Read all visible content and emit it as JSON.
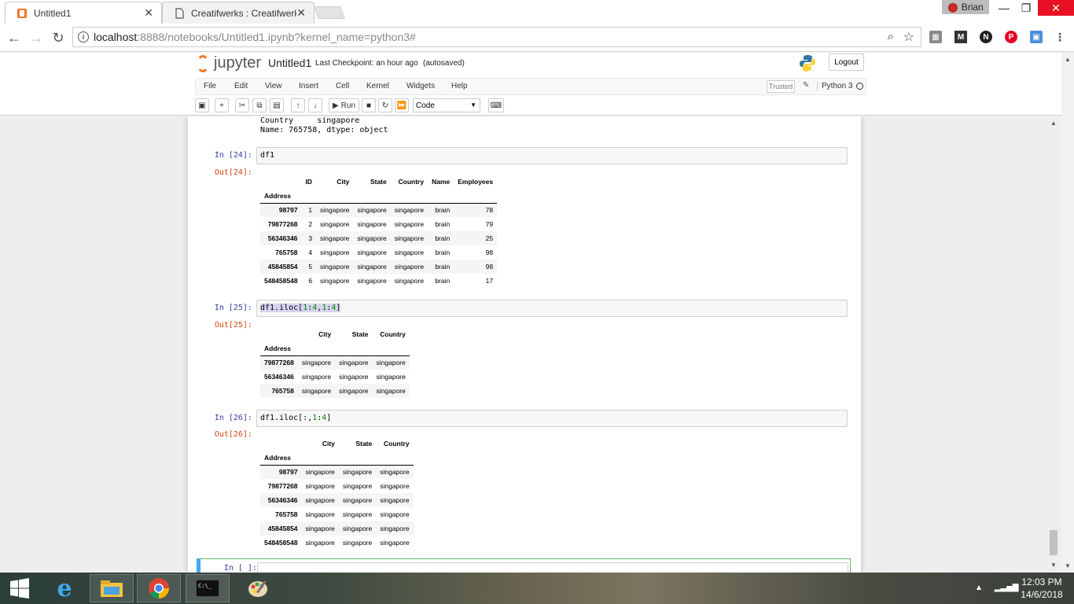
{
  "browser": {
    "tabs": [
      {
        "title": "Untitled1",
        "active": true
      },
      {
        "title": "Creatifwerks : Creatifwerk",
        "active": false
      }
    ],
    "profile_name": "Brian",
    "url_host": "localhost",
    "url_path": ":8888/notebooks/Untitled1.ipynb?kernel_name=python3#",
    "extensions": [
      "apps-icon",
      "M",
      "N",
      "pinterest-icon",
      "tab-icon"
    ]
  },
  "jupyter": {
    "logo_text": "jupyter",
    "notebook_name": "Untitled1",
    "checkpoint": "Last Checkpoint: an hour ago",
    "autosave": "(autosaved)",
    "logout_label": "Logout",
    "menu": [
      "File",
      "Edit",
      "View",
      "Insert",
      "Cell",
      "Kernel",
      "Widgets",
      "Help"
    ],
    "trusted_label": "Trusted",
    "kernel_name": "Python 3",
    "run_label": "Run",
    "cell_type": "Code"
  },
  "cells": {
    "prev_output": {
      "line1": "Country     singapore",
      "line2": "Name: 765758, dtype: object"
    },
    "c24": {
      "in_prompt": "In [24]:",
      "code": "df1",
      "out_prompt": "Out[24]:",
      "columns": [
        "ID",
        "City",
        "State",
        "Country",
        "Name",
        "Employees"
      ],
      "index_name": "Address",
      "rows": [
        {
          "idx": "98797",
          "vals": [
            "1",
            "singapore",
            "singapore",
            "singapore",
            "brain",
            "78"
          ]
        },
        {
          "idx": "79877268",
          "vals": [
            "2",
            "singapore",
            "singapore",
            "singapore",
            "brain",
            "79"
          ]
        },
        {
          "idx": "56346346",
          "vals": [
            "3",
            "singapore",
            "singapore",
            "singapore",
            "brain",
            "25"
          ]
        },
        {
          "idx": "765758",
          "vals": [
            "4",
            "singapore",
            "singapore",
            "singapore",
            "brain",
            "98"
          ]
        },
        {
          "idx": "45845854",
          "vals": [
            "5",
            "singapore",
            "singapore",
            "singapore",
            "brain",
            "98"
          ]
        },
        {
          "idx": "548458548",
          "vals": [
            "6",
            "singapore",
            "singapore",
            "singapore",
            "brain",
            "17"
          ]
        }
      ]
    },
    "c25": {
      "in_prompt": "In [25]:",
      "code_prefix": "df1.iloc[",
      "code_a": "1",
      "code_b": ":",
      "code_c": "4",
      "code_d": ",",
      "code_e": "1",
      "code_f": ":",
      "code_g": "4",
      "code_suffix": "]",
      "out_prompt": "Out[25]:",
      "columns": [
        "City",
        "State",
        "Country"
      ],
      "index_name": "Address",
      "rows": [
        {
          "idx": "79877268",
          "vals": [
            "singapore",
            "singapore",
            "singapore"
          ]
        },
        {
          "idx": "56346346",
          "vals": [
            "singapore",
            "singapore",
            "singapore"
          ]
        },
        {
          "idx": "765758",
          "vals": [
            "singapore",
            "singapore",
            "singapore"
          ]
        }
      ]
    },
    "c26": {
      "in_prompt": "In [26]:",
      "code_prefix": "df1.iloc[:,",
      "code_a": "1",
      "code_b": ":",
      "code_c": "4",
      "code_suffix": "]",
      "out_prompt": "Out[26]:",
      "columns": [
        "City",
        "State",
        "Country"
      ],
      "index_name": "Address",
      "rows": [
        {
          "idx": "98797",
          "vals": [
            "singapore",
            "singapore",
            "singapore"
          ]
        },
        {
          "idx": "79877268",
          "vals": [
            "singapore",
            "singapore",
            "singapore"
          ]
        },
        {
          "idx": "56346346",
          "vals": [
            "singapore",
            "singapore",
            "singapore"
          ]
        },
        {
          "idx": "765758",
          "vals": [
            "singapore",
            "singapore",
            "singapore"
          ]
        },
        {
          "idx": "45845854",
          "vals": [
            "singapore",
            "singapore",
            "singapore"
          ]
        },
        {
          "idx": "548458548",
          "vals": [
            "singapore",
            "singapore",
            "singapore"
          ]
        }
      ]
    },
    "new_cell": {
      "in_prompt": "In [ ]:"
    }
  },
  "taskbar": {
    "apps": [
      "windows-start",
      "internet-explorer",
      "file-explorer",
      "chrome",
      "command-prompt",
      "paint"
    ],
    "time": "12:03 PM",
    "date": "14/6/2018"
  }
}
